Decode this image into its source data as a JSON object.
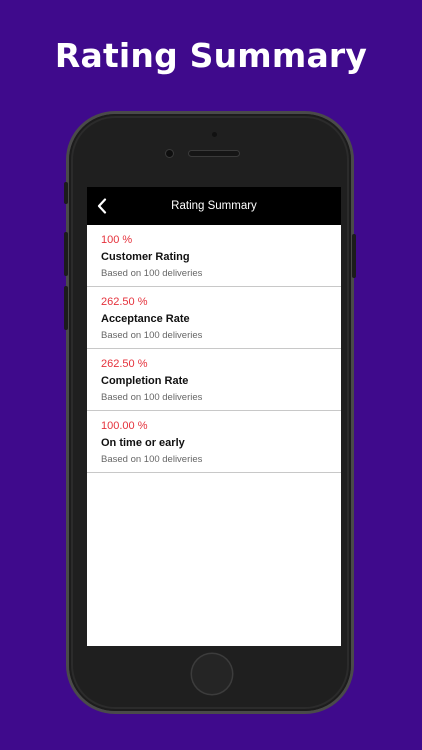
{
  "headline": "Rating Summary",
  "screen": {
    "nav_title": "Rating Summary",
    "back_icon": "chevron-left-icon",
    "items": [
      {
        "percent": "100 %",
        "title": "Customer Rating",
        "subtitle": "Based on 100 deliveries"
      },
      {
        "percent": "262.50 %",
        "title": "Acceptance Rate",
        "subtitle": "Based on 100 deliveries"
      },
      {
        "percent": "262.50 %",
        "title": "Completion Rate",
        "subtitle": "Based on 100 deliveries"
      },
      {
        "percent": "100.00 %",
        "title": "On time or early",
        "subtitle": "Based on 100 deliveries"
      }
    ]
  },
  "colors": {
    "background": "#3f0a8c",
    "percent": "#e5323c",
    "navbar": "#000000"
  }
}
